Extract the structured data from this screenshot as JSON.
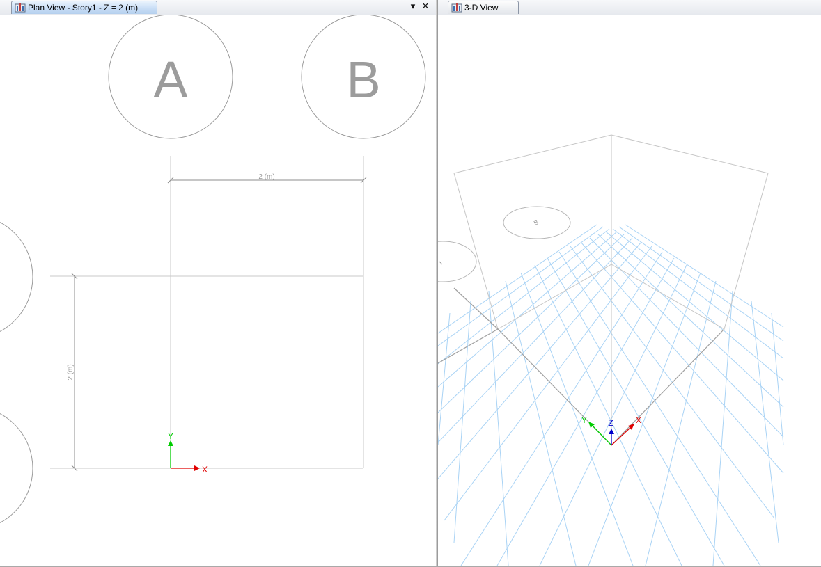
{
  "left_panel": {
    "tab_title": "Plan View - Story1 - Z = 2 (m)",
    "dropdown_glyph": "▾",
    "close_glyph": "✕",
    "grid_bubbles": [
      {
        "label": "A"
      },
      {
        "label": "B"
      }
    ],
    "dimensions": {
      "horizontal": "2 (m)",
      "vertical": "2 (m)"
    },
    "axes": {
      "x": "X",
      "y": "Y"
    }
  },
  "right_panel": {
    "tab_title": "3-D View",
    "bubble_label": "B",
    "axes": {
      "x": "X",
      "y": "Y",
      "z": "Z"
    }
  },
  "colors": {
    "x_axis": "#e00000",
    "y_axis": "#00cc00",
    "z_axis": "#0000cc",
    "grid_line": "#a9d3f5",
    "model_line": "#9a9a9a",
    "bubble_line": "#9a9a9a",
    "bubble_text": "#999999",
    "tab_active": "#c9def6"
  },
  "icons": {
    "tab_icon": "model-view-icon",
    "dropdown": "chevron-down-icon",
    "close": "close-icon"
  }
}
